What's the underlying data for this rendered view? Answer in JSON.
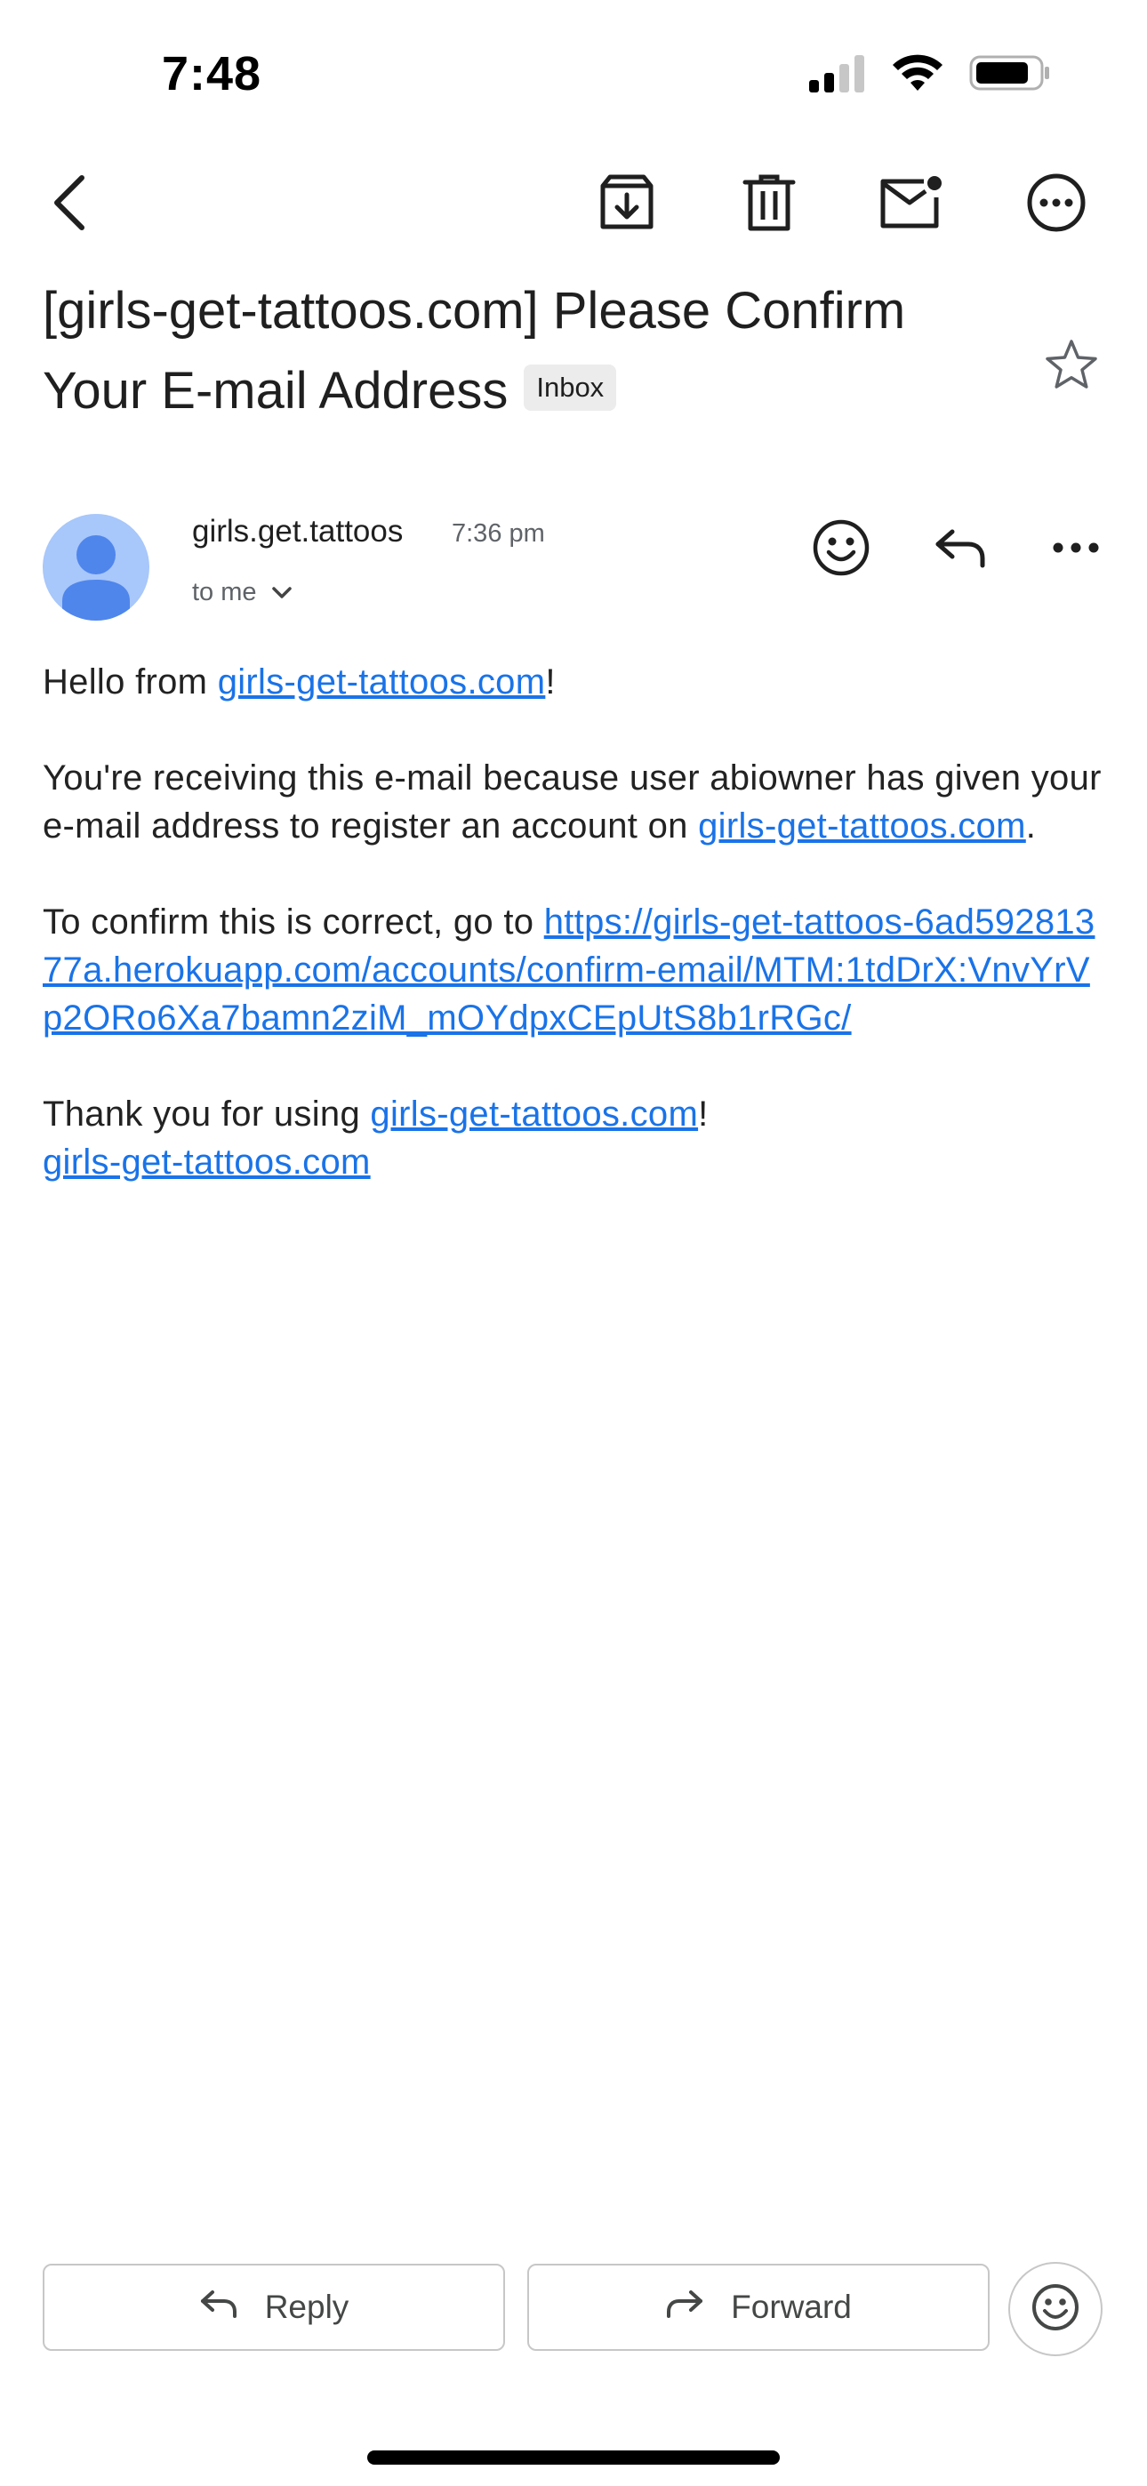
{
  "status_bar": {
    "time": "7:48",
    "icons": [
      "cellular-signal-icon",
      "wifi-icon",
      "battery-icon"
    ]
  },
  "toolbar": {
    "icons": [
      "back-arrow-icon",
      "archive-icon",
      "trash-icon",
      "mark-unread-icon",
      "more-circle-icon"
    ]
  },
  "email": {
    "subject": "[girls-get-tattoos.com] Please Confirm Your E-mail Address",
    "label": "Inbox",
    "sender": "girls.get.tattoos",
    "time": "7:36 pm",
    "recipient": "to me",
    "body": {
      "greeting_prefix": "Hello from ",
      "greeting_link": "girls-get-tattoos.com",
      "greeting_suffix": "!",
      "p2_text": "You're receiving this e-mail because user abiowner has given your e-mail address to register an account on ",
      "p2_link": "girls-get-tattoos.com",
      "p2_suffix": ".",
      "p3_text": "To confirm this is correct, go to ",
      "p3_link": "https://girls-get-tattoos-6ad59281377a.herokuapp.com/accounts/confirm-email/MTM:1tdDrX:VnvYrVp2ORo6Xa7bamn2ziM_mOYdpxCEpUtS8b1rRGc/",
      "p4_text": "Thank you for using ",
      "p4_link": "girls-get-tattoos.com",
      "p4_suffix": "!",
      "signature_link": "girls-get-tattoos.com"
    }
  },
  "actions": {
    "reply_label": "Reply",
    "forward_label": "Forward"
  },
  "colors": {
    "link": "#1a73e8",
    "avatar_bg": "#a8c7fa",
    "avatar_fg": "#4f86ec"
  }
}
